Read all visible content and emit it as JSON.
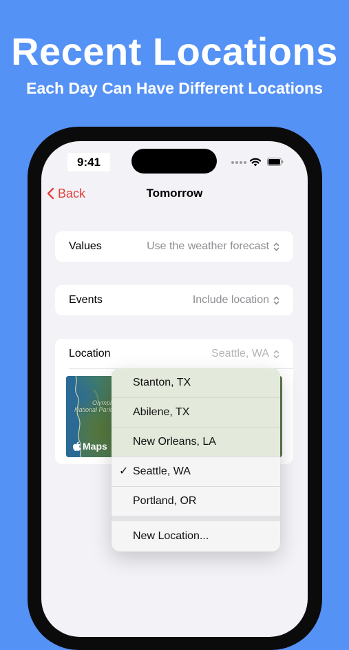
{
  "promo": {
    "headline": "Recent Locations",
    "subheadline": "Each Day Can Have Different Locations"
  },
  "status_bar": {
    "time": "9:41"
  },
  "nav": {
    "back_label": "Back",
    "title": "Tomorrow"
  },
  "settings": {
    "values": {
      "label": "Values",
      "value": "Use the weather forecast"
    },
    "events": {
      "label": "Events",
      "value": "Include location"
    },
    "location": {
      "label": "Location",
      "value": "Seattle, WA"
    }
  },
  "map": {
    "park_label_line1": "Olympic",
    "park_label_line2": "National Park",
    "badge": "Maps"
  },
  "location_menu": {
    "items": [
      {
        "label": "Stanton, TX",
        "checked": false
      },
      {
        "label": "Abilene, TX",
        "checked": false
      },
      {
        "label": "New Orleans, LA",
        "checked": false
      },
      {
        "label": "Seattle, WA",
        "checked": true
      },
      {
        "label": "Portland, OR",
        "checked": false
      }
    ],
    "check_mark": "✓",
    "new_location": "New Location..."
  },
  "colors": {
    "background": "#5592f6",
    "accent": "#e5403a",
    "secondary_text": "#8e8e93"
  },
  "icons": {
    "back": "chevron-left-icon",
    "selector": "chevron-up-down-icon",
    "wifi": "wifi-icon",
    "battery": "battery-icon",
    "maps_logo": "apple-logo-icon"
  }
}
